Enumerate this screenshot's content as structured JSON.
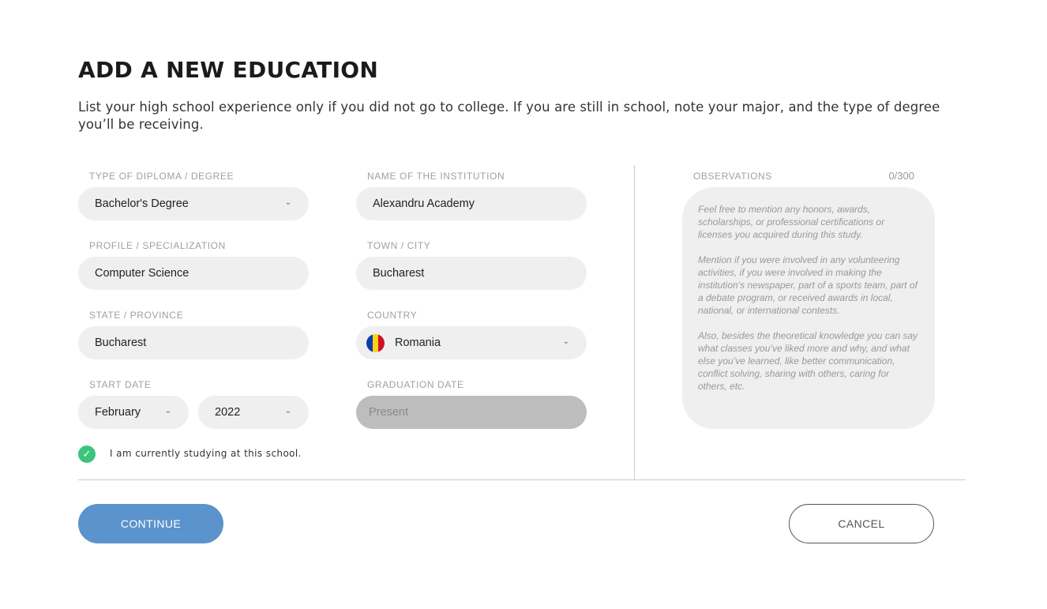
{
  "title": "ADD A NEW EDUCATION",
  "description": "List your high school experience only if you did not go to college. If you are still in school, note your major, and the type of degree you’ll be receiving.",
  "fields": {
    "degree": {
      "label": "TYPE OF DIPLOMA / DEGREE",
      "value": "Bachelor's Degree"
    },
    "institution": {
      "label": "NAME OF THE INSTITUTION",
      "value": "Alexandru Academy"
    },
    "profile": {
      "label": "PROFILE / SPECIALIZATION",
      "value": "Computer Science"
    },
    "town": {
      "label": "TOWN / CITY",
      "value": "Bucharest"
    },
    "state": {
      "label": "STATE / PROVINCE",
      "value": "Bucharest"
    },
    "country": {
      "label": "COUNTRY",
      "value": "Romania",
      "flag_icon": "romania-flag-icon"
    },
    "start_date": {
      "label": "START DATE",
      "month": "February",
      "year": "2022"
    },
    "graduation_date": {
      "label": "GRADUATION DATE",
      "placeholder": "Present"
    }
  },
  "currently_studying": {
    "label": "I am currently studying at this school.",
    "checked": true,
    "color": "#3cc47c"
  },
  "observations": {
    "label": "OBSERVATIONS",
    "counter": "0/300",
    "placeholder_paragraphs": [
      "Feel free to mention any honors, awards, scholarships, or professional certifications or licenses you acquired during this study.",
      " Mention if you were involved in any volunteering activities, if you were involved in making the institution’s newspaper, part of a sports team, part of a debate program, or received awards in local, national, or international contests.",
      " Also, besides the theoretical knowledge you can say what classes you’ve liked more and why, and what else you’ve learned, like better communication, conflict solving, sharing with others, caring for others, etc."
    ]
  },
  "buttons": {
    "continue": "CONTINUE",
    "cancel": "CANCEL",
    "accent": "#5b93cc"
  }
}
